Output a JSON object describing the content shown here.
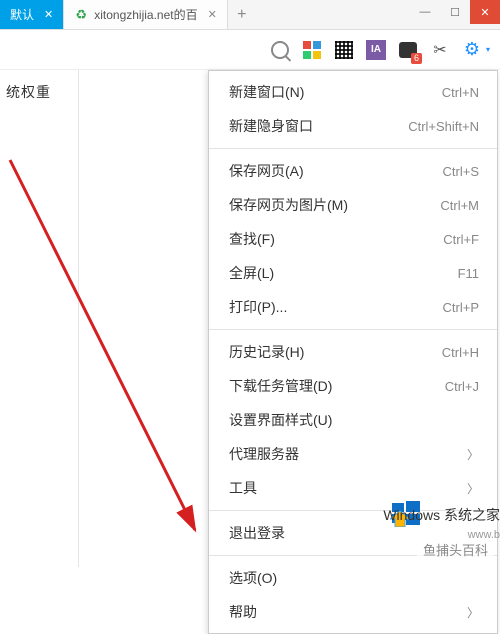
{
  "tabs": {
    "active_label": "默认",
    "inactive_label": "xitongzhijia.net的百"
  },
  "toolbar": {
    "ia_label": "IA",
    "badge_count": "6"
  },
  "sidebar": {
    "text": "统权重"
  },
  "menu": {
    "items": [
      {
        "label": "新建窗口(N)",
        "shortcut": "Ctrl+N"
      },
      {
        "label": "新建隐身窗口",
        "shortcut": "Ctrl+Shift+N"
      }
    ],
    "group2": [
      {
        "label": "保存网页(A)",
        "shortcut": "Ctrl+S"
      },
      {
        "label": "保存网页为图片(M)",
        "shortcut": "Ctrl+M"
      },
      {
        "label": "查找(F)",
        "shortcut": "Ctrl+F"
      },
      {
        "label": "全屏(L)",
        "shortcut": "F11"
      },
      {
        "label": "打印(P)...",
        "shortcut": "Ctrl+P"
      }
    ],
    "group3": [
      {
        "label": "历史记录(H)",
        "shortcut": "Ctrl+H"
      },
      {
        "label": "下载任务管理(D)",
        "shortcut": "Ctrl+J"
      },
      {
        "label": "设置界面样式(U)",
        "shortcut": ""
      },
      {
        "label": "代理服务器",
        "shortcut": "",
        "submenu": true
      },
      {
        "label": "工具",
        "shortcut": "",
        "submenu": true
      }
    ],
    "group4": [
      {
        "label": "退出登录",
        "shortcut": ""
      }
    ],
    "group5": [
      {
        "label": "选项(O)",
        "shortcut": ""
      },
      {
        "label": "帮助",
        "shortcut": "",
        "submenu": true
      }
    ]
  },
  "watermark": {
    "brand_suffix": "系统之家",
    "url_fragment": "www.b",
    "corner": "鱼捕头百科"
  }
}
